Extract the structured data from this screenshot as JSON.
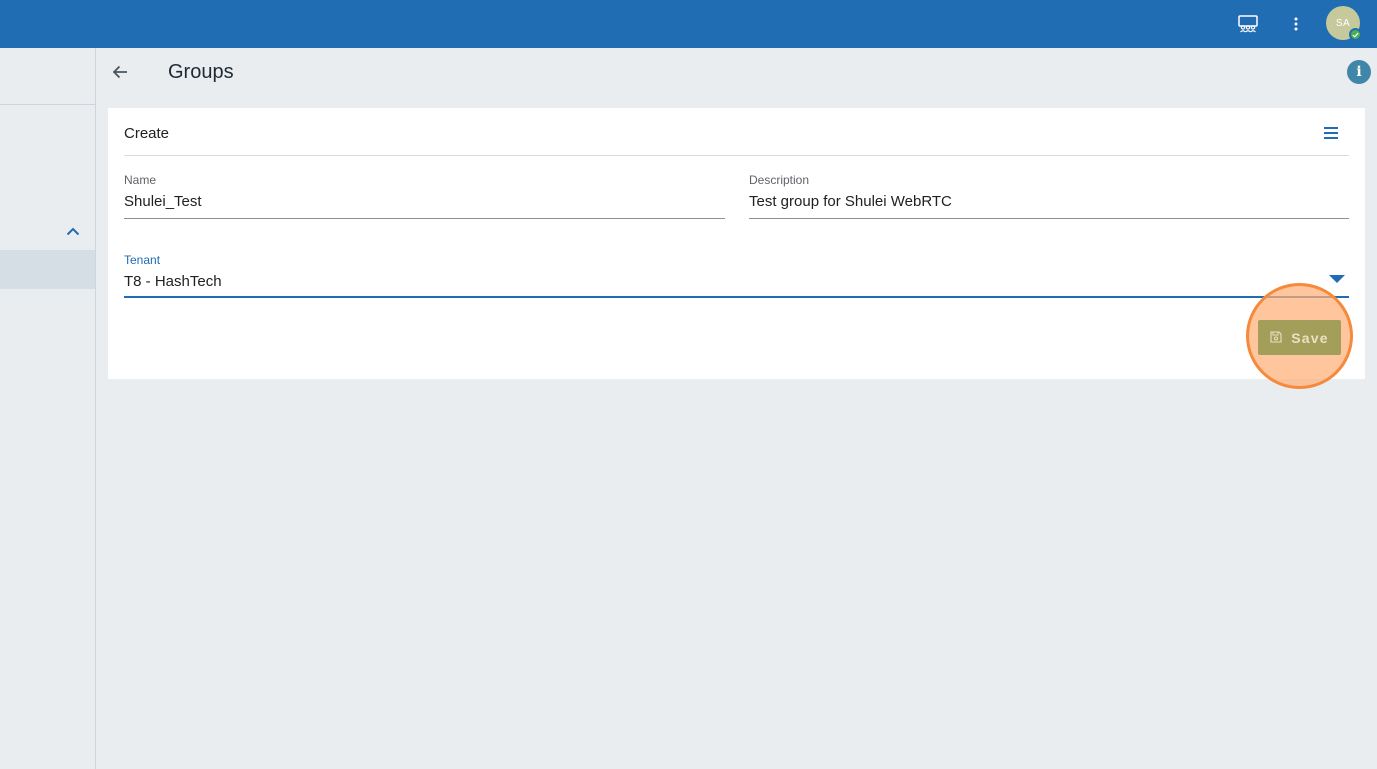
{
  "topbar": {
    "icons": [
      "rooms-icon",
      "more-vertical-icon"
    ],
    "avatar_initials": "SA",
    "accent_color": "#216db3"
  },
  "page": {
    "title": "Groups"
  },
  "card": {
    "title": "Create",
    "fields": {
      "name": {
        "label": "Name",
        "value": "Shulei_Test"
      },
      "description": {
        "label": "Description",
        "value": "Test group for Shulei WebRTC"
      },
      "tenant": {
        "label": "Tenant",
        "value": "T8 - HashTech"
      }
    },
    "save_label": "Save"
  }
}
